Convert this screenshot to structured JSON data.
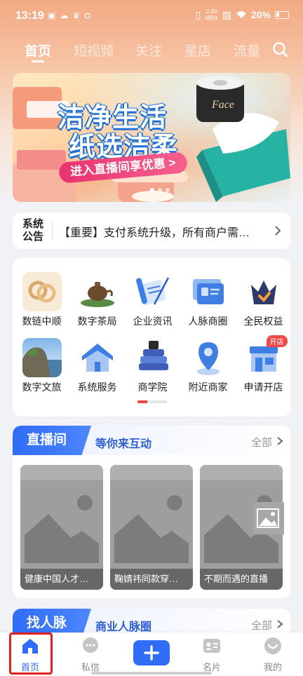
{
  "status_bar": {
    "time": "13:19",
    "net_speed_top": "2.00",
    "net_speed_bottom": "MB/s",
    "battery": "20%"
  },
  "top_tabs": [
    {
      "label": "首页",
      "active": true
    },
    {
      "label": "短视频",
      "active": false
    },
    {
      "label": "关注",
      "active": false
    },
    {
      "label": "星店",
      "active": false
    },
    {
      "label": "流量",
      "active": false
    }
  ],
  "banner": {
    "title_line1": "洁净生活",
    "title_line2": "纸选洁柔",
    "cta": "进入直播间享优惠 >",
    "product_text": "Face"
  },
  "notice": {
    "tag_line1": "系统",
    "tag_line2": "公告",
    "text": "【重要】支付系统升级，所有商户需…"
  },
  "grid_items": [
    {
      "label": "数链中顺",
      "icon": "knot-logo-icon"
    },
    {
      "label": "数字茶局",
      "icon": "teapot-icon"
    },
    {
      "label": "企业资讯",
      "icon": "scroll-icon"
    },
    {
      "label": "人脉商圈",
      "icon": "contact-card-icon"
    },
    {
      "label": "全民权益",
      "icon": "crown-badge-icon"
    },
    {
      "label": "数字文旅",
      "icon": "landscape-icon"
    },
    {
      "label": "系统服务",
      "icon": "house-icon"
    },
    {
      "label": "商学院",
      "icon": "books-icon"
    },
    {
      "label": "附近商家",
      "icon": "location-pin-icon"
    },
    {
      "label": "申请开店",
      "icon": "storefront-icon",
      "badge": "开店"
    }
  ],
  "live_section": {
    "title": "直播间",
    "subtitle": "等你来互动",
    "all_label": "全部",
    "items": [
      {
        "caption": "健康中国人才…"
      },
      {
        "caption": "鞠婧祎同款穿…"
      },
      {
        "caption": "不期而遇的直播"
      }
    ]
  },
  "people_section": {
    "title": "找人脉",
    "subtitle": "商业人脉圈",
    "all_label": "全部"
  },
  "bottom_nav": [
    {
      "label": "首页",
      "active": true
    },
    {
      "label": "私信",
      "active": false
    },
    {
      "label": "",
      "active": false
    },
    {
      "label": "名片",
      "active": false
    },
    {
      "label": "我的",
      "active": false
    }
  ],
  "colors": {
    "accent": "#2f6df6",
    "header_gradient_top": "#f3a982",
    "highlight_box": "#e02020"
  }
}
